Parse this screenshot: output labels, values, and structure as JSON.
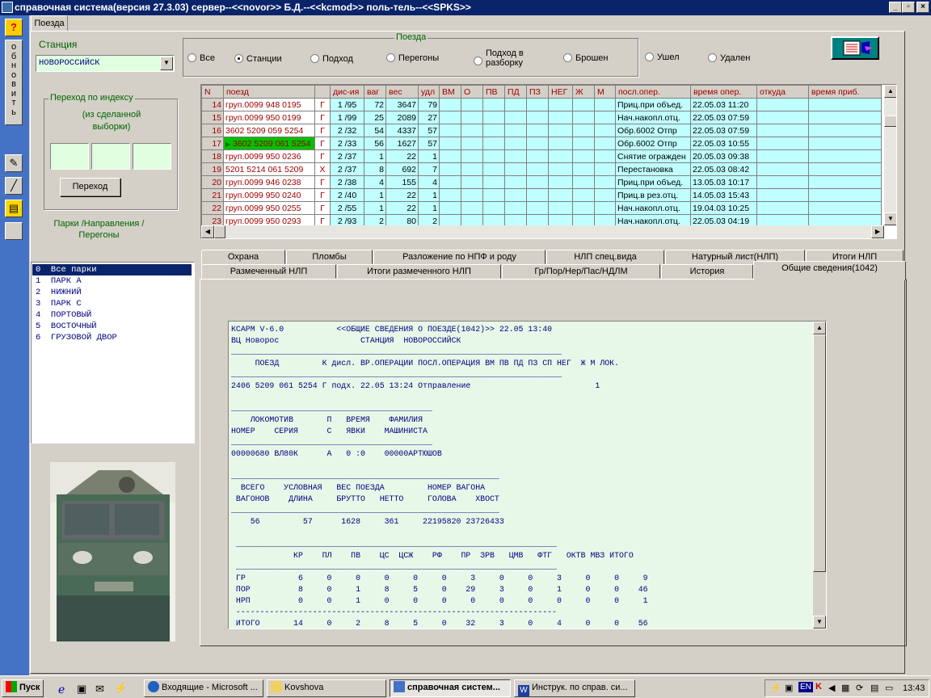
{
  "window": {
    "title": "справочная система(версия 27.3.03) сервер--<<novor>> Б.Д.--<<kcmod>> поль-тель--<<SPKS>>",
    "minimize": "_",
    "maximize": "▫",
    "close": "×"
  },
  "sidebar": {
    "help": "?",
    "refresh": "о\nб\nн\nо\nв\nи\nт\nь"
  },
  "main_tab": "Поезда",
  "station": {
    "label": "Станция",
    "value": "НОВОРОССИЙСК"
  },
  "jump": {
    "title": "Переход  по индексу",
    "subtitle": "(из сделанной\nвыборки)",
    "button": "Переход"
  },
  "parks": {
    "title": "Парки /Направления /\nПерегоны",
    "items": [
      "0  Все парки",
      "1  ПАРК А",
      "2  НИЖНИЙ",
      "3  ПАРК С",
      "4  ПОРТОВЫЙ",
      "5  ВОСТОЧНЫЙ",
      "6  ГРУЗОВОЙ ДВОР"
    ]
  },
  "trains_filter": {
    "title": "Поезда",
    "options": [
      "Все",
      "Станции",
      "Подход",
      "Перегоны",
      "Подход в\nразборку",
      "Брошен",
      "Ушел",
      "Удален"
    ],
    "selected": 1
  },
  "grid": {
    "columns": [
      "N",
      "поезд",
      "",
      "дис-ия",
      "ваг",
      "вес",
      "удл",
      "ВМ",
      "О",
      "ПВ",
      "ПД",
      "ПЗ",
      "НЕГ",
      "Ж",
      "М",
      "посл.опер.",
      "время опер.",
      "откуда",
      "время приб."
    ],
    "rows": [
      [
        "14",
        "груп.0099 948 0195",
        "Г",
        "1 /95",
        "72",
        "3647",
        "79",
        "",
        "",
        "",
        "",
        "",
        "",
        "",
        "",
        "Приц.при объед.",
        "22.05.03 11:20",
        "",
        ""
      ],
      [
        "15",
        "груп.0099 950 0199",
        "Г",
        "1 /99",
        "25",
        "2089",
        "27",
        "",
        "",
        "",
        "",
        "",
        "",
        "",
        "",
        "Нач.накопл.отц.",
        "22.05.03 07:59",
        "",
        ""
      ],
      [
        "16",
        "3602 5209 059 5254",
        "Г",
        "2 /32",
        "54",
        "4337",
        "57",
        "",
        "",
        "",
        "",
        "",
        "",
        "",
        "",
        "Обр.6002 Отпр",
        "22.05.03 07:59",
        "",
        ""
      ],
      [
        "17",
        "3602 5209 061 5254",
        "Г",
        "2 /33",
        "56",
        "1627",
        "57",
        "",
        "",
        "",
        "",
        "",
        "",
        "",
        "",
        "Обр.6002 Отпр",
        "22.05.03 10:55",
        "",
        ""
      ],
      [
        "18",
        "груп.0099 950 0236",
        "Г",
        "2 /37",
        "1",
        "22",
        "1",
        "",
        "",
        "",
        "",
        "",
        "",
        "",
        "",
        "Снятие огражден",
        "20.05.03 09:38",
        "",
        ""
      ],
      [
        "19",
        "5201 5214 061 5209",
        "Х",
        "2 /37",
        "8",
        "692",
        "7",
        "",
        "",
        "",
        "",
        "",
        "",
        "",
        "",
        "Перестановка",
        "22.05.03 08:42",
        "",
        ""
      ],
      [
        "20",
        "груп.0099 946 0238",
        "Г",
        "2 /38",
        "4",
        "155",
        "4",
        "",
        "",
        "",
        "",
        "",
        "",
        "",
        "",
        "Приц.при объед.",
        "13.05.03 10:17",
        "",
        ""
      ],
      [
        "21",
        "груп.0099 950 0240",
        "Г",
        "2 /40",
        "1",
        "22",
        "1",
        "",
        "",
        "",
        "",
        "",
        "",
        "",
        "",
        "Приц.в рез.отц.",
        "14.05.03 15:43",
        "",
        ""
      ],
      [
        "22",
        "груп.0099 950 0255",
        "Г",
        "2 /55",
        "1",
        "22",
        "1",
        "",
        "",
        "",
        "",
        "",
        "",
        "",
        "",
        "Нач.накопл.отц.",
        "19.04.03 10:25",
        "",
        ""
      ],
      [
        "23",
        "груп.0099 950 0293",
        "Г",
        "2 /93",
        "2",
        "80",
        "2",
        "",
        "",
        "",
        "",
        "",
        "",
        "",
        "",
        "Нач.накопл.отц.",
        "22.05.03 04:19",
        "",
        ""
      ]
    ],
    "selected_row": 3
  },
  "tabs_row1": [
    "Охрана",
    "Пломбы",
    "Разложение по НПФ и роду",
    "НЛП спец.вида",
    "Натурный лист(НЛП)",
    "Итоги НЛП"
  ],
  "tabs_row2": [
    "Размеченный НЛП",
    "Итоги размеченного НЛП",
    "Гр/Пор/Нер/Пас/НДЛМ",
    "История",
    "Общие сведения(1042)"
  ],
  "report": {
    "lines": [
      "КСАРМ V-6.0           <<ОБЩИЕ СВЕДЕНИЯ О ПОЕЗДЕ(1042)>> 22.05 13:40",
      "ВЦ Новорос                 СТАНЦИЯ  НОВОРОССИЙСК",
      "_____________________________________________________________________",
      "     ПОЕЗД         К дисл. ВР.ОПЕРАЦИИ ПОСЛ.ОПЕРАЦИЯ ВМ ПВ ПД ПЗ СП НЕГ  Ж М ЛОК.",
      "_____________________________________________________________________",
      "2406 5209 061 5254 Г подх. 22.05 13:24 Отправление                          1",
      "",
      "__________________________________________",
      "    ЛОКОМОТИВ       П   ВРЕМЯ    ФАМИЛИЯ",
      "НОМЕР    СЕРИЯ      С   ЯВКИ    МАШИНИСТА",
      "__________________________________________",
      "00000680 ВЛ80К      А   0 :0    00000АРТЮШОВ",
      "",
      "________________________________________________________",
      "  ВСЕГО    УСЛОВНАЯ   ВЕС ПОЕЗДА         НОМЕР ВАГОНА",
      " ВАГОНОВ    ДЛИНА     БРУТТО   НЕТТО     ГОЛОВА    ХВОСТ",
      "________________________________________________________",
      "    56         57      1628     361     22195820 23726433",
      "",
      " ___________________________________________________________________",
      "             КР    ПЛ    ПВ    ЦС  ЦСЖ    РФ    ПР  ЗРВ   ЦМВ   ФТГ   ОКТВ МВЗ ИТОГО",
      " ___________________________________________________________________",
      " ГР           6     0     0     0     0     0     3     0     0     3     0     0     9",
      " ПОР          8     0     1     8     5     0    29     3     0     1     0     0    46",
      " НРП          0     0     1     0     0     0     0     0     0     0     0     0     1",
      " -------------------------------------------------------------------",
      " ИТОГО       14     0     2     8     5     0    32     3     0     4     0     0    56"
    ]
  },
  "taskbar": {
    "start": "Пуск",
    "tasks": [
      "Входящие - Microsoft ...",
      "Kovshova",
      "справочная систем...",
      "Инструк. по справ. си..."
    ],
    "active": 2,
    "lang": "EN",
    "clock": "13:43"
  },
  "colors": {
    "title_bg": "#0a246a",
    "sidebar": "#4472c4",
    "grid_cell": "#c0ffff",
    "header_red": "#a00000",
    "selected_green": "#00c000",
    "report_bg": "#e8f8e8",
    "report_text": "#000080"
  }
}
